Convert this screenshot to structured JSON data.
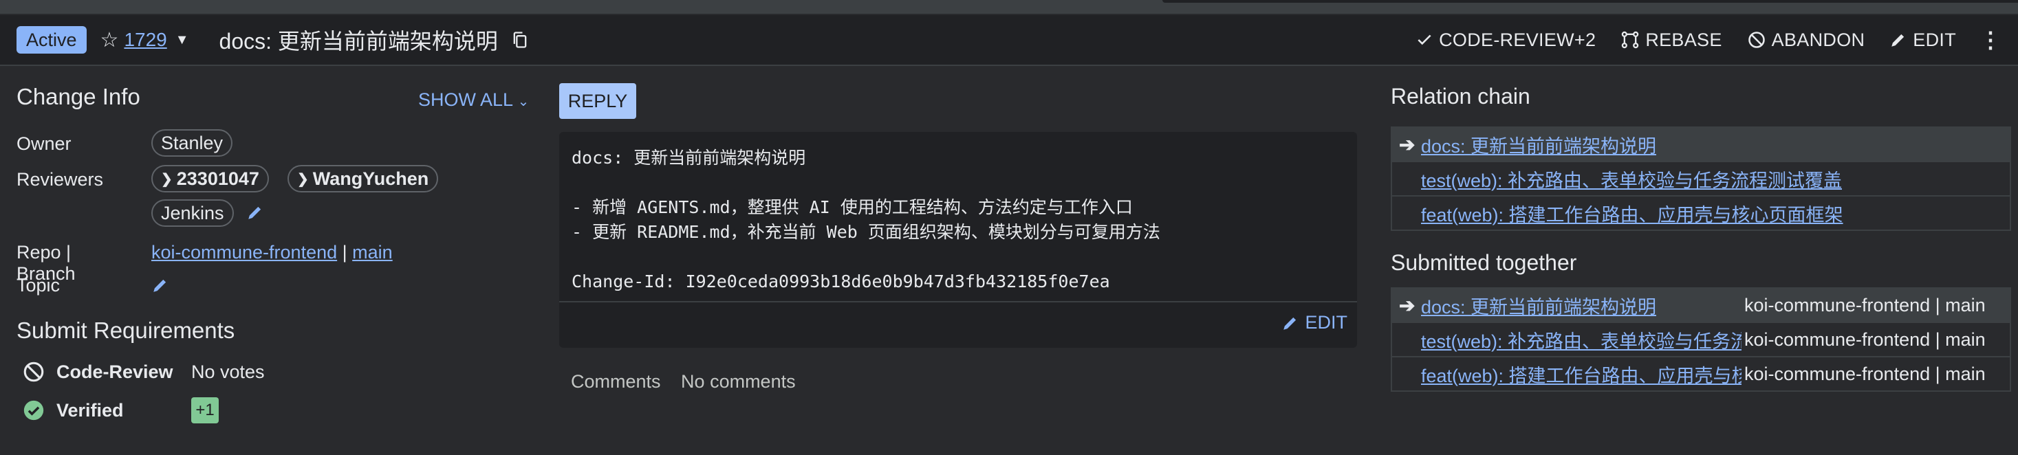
{
  "header": {
    "status": "Active",
    "change_number": "1729",
    "title": "docs: 更新当前前端架构说明",
    "actions": {
      "code_review": "CODE-REVIEW+2",
      "rebase": "REBASE",
      "abandon": "ABANDON",
      "edit": "EDIT"
    }
  },
  "change_info": {
    "title": "Change Info",
    "show_all": "SHOW ALL",
    "owner_label": "Owner",
    "owner": "Stanley",
    "reviewers_label": "Reviewers",
    "reviewers": [
      "23301047",
      "WangYuchen",
      "Jenkins"
    ],
    "repo_branch_label": "Repo | Branch",
    "repo": "koi-commune-frontend",
    "separator": "|",
    "branch": "main",
    "topic_label": "Topic"
  },
  "submit_requirements": {
    "title": "Submit Requirements",
    "items": [
      {
        "name": "Code-Review",
        "status": "No votes"
      },
      {
        "name": "Verified",
        "vote": "+1"
      }
    ]
  },
  "message": {
    "reply_label": "REPLY",
    "text": "docs: 更新当前前端架构说明\n\n- 新增 AGENTS.md，整理供 AI 使用的工程结构、方法约定与工作入口\n- 更新 README.md，补充当前 Web 页面组织架构、模块划分与可复用方法\n\nChange-Id: I92e0ceda0993b18d6e0b9b47d3fb432185f0e7ea",
    "edit_label": "EDIT"
  },
  "comments": {
    "label": "Comments",
    "value": "No comments"
  },
  "relation_chain": {
    "title": "Relation chain",
    "items": [
      "docs: 更新当前前端架构说明",
      "test(web): 补充路由、表单校验与任务流程测试覆盖",
      "feat(web): 搭建工作台路由、应用壳与核心页面框架"
    ]
  },
  "submitted_together": {
    "title": "Submitted together",
    "items": [
      {
        "subject": "docs: 更新当前前端架构说明",
        "repo_branch": "koi-commune-frontend | main"
      },
      {
        "subject": "test(web): 补充路由、表单校验与任务流程测试覆盖",
        "repo_branch": "koi-commune-frontend | main"
      },
      {
        "subject": "feat(web): 搭建工作台路由、应用壳与核心页面框架",
        "repo_branch": "koi-commune-frontend | main"
      }
    ]
  },
  "colors": {
    "background": "#292a2d",
    "header_bg": "#202124",
    "accent": "#8ab4f8",
    "verified": "#81c995"
  },
  "icons": [
    "star-icon",
    "copy-icon",
    "check-icon",
    "rebase-icon",
    "abandon-icon",
    "pencil-icon",
    "more-vert-icon",
    "chevron-down-icon",
    "arrow-right-icon",
    "check-circle-icon",
    "block-icon"
  ]
}
